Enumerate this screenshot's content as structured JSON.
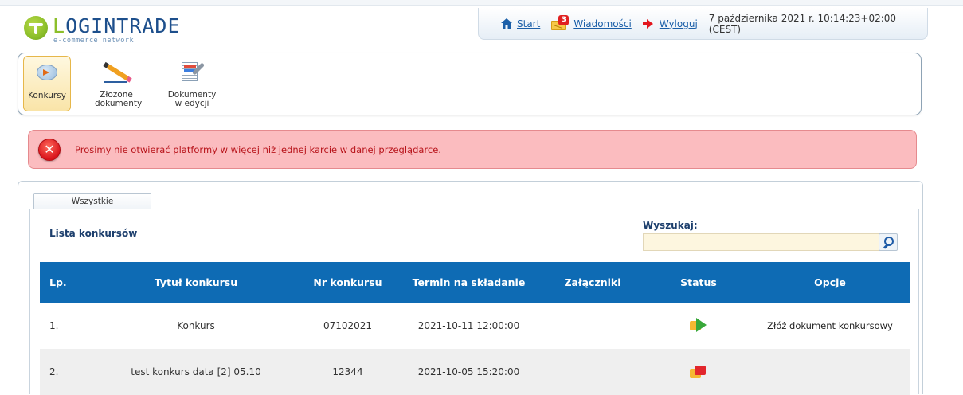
{
  "header": {
    "logo_text_green": "L",
    "logo_text_rest": "OGINTRADE",
    "logo_sub": "e-commerce network",
    "nav": {
      "start": "Start",
      "messages_count": "3",
      "messages": "Wiadomości",
      "logout": "Wyloguj",
      "datetime": "7 października 2021 r. 10:14:23+02:00 (CEST)"
    }
  },
  "toolbar": {
    "items": [
      {
        "label": "Konkursy",
        "active": true
      },
      {
        "label": "Złożone dokumenty",
        "active": false
      },
      {
        "label": "Dokumenty w edycji",
        "active": false
      }
    ]
  },
  "alert": {
    "message": "Prosimy nie otwierać platformy w więcej niż jednej karcie w danej przeglądarce."
  },
  "main": {
    "tab_label": "Wszystkie",
    "list_title": "Lista konkursów",
    "search_label": "Wyszukaj:",
    "search_value": "",
    "columns": [
      "Lp.",
      "Tytuł konkursu",
      "Nr konkursu",
      "Termin na składanie",
      "Załączniki",
      "Status",
      "Opcje"
    ],
    "rows": [
      {
        "lp": "1.",
        "title": "Konkurs",
        "nr": "07102021",
        "deadline": "2021-10-11 12:00:00",
        "attachments": "",
        "status": "active",
        "option": "Złóż dokument konkursowy"
      },
      {
        "lp": "2.",
        "title": "test konkurs data [2] 05.10",
        "nr": "12344",
        "deadline": "2021-10-05 15:20:00",
        "attachments": "",
        "status": "closed",
        "option": ""
      }
    ]
  },
  "colors": {
    "header_blue": "#0e6bb4",
    "alert_bg": "#fbbcbf",
    "alert_text": "#b8141b",
    "logo_green": "#8cbf2a",
    "logo_blue": "#1d4f8c"
  }
}
